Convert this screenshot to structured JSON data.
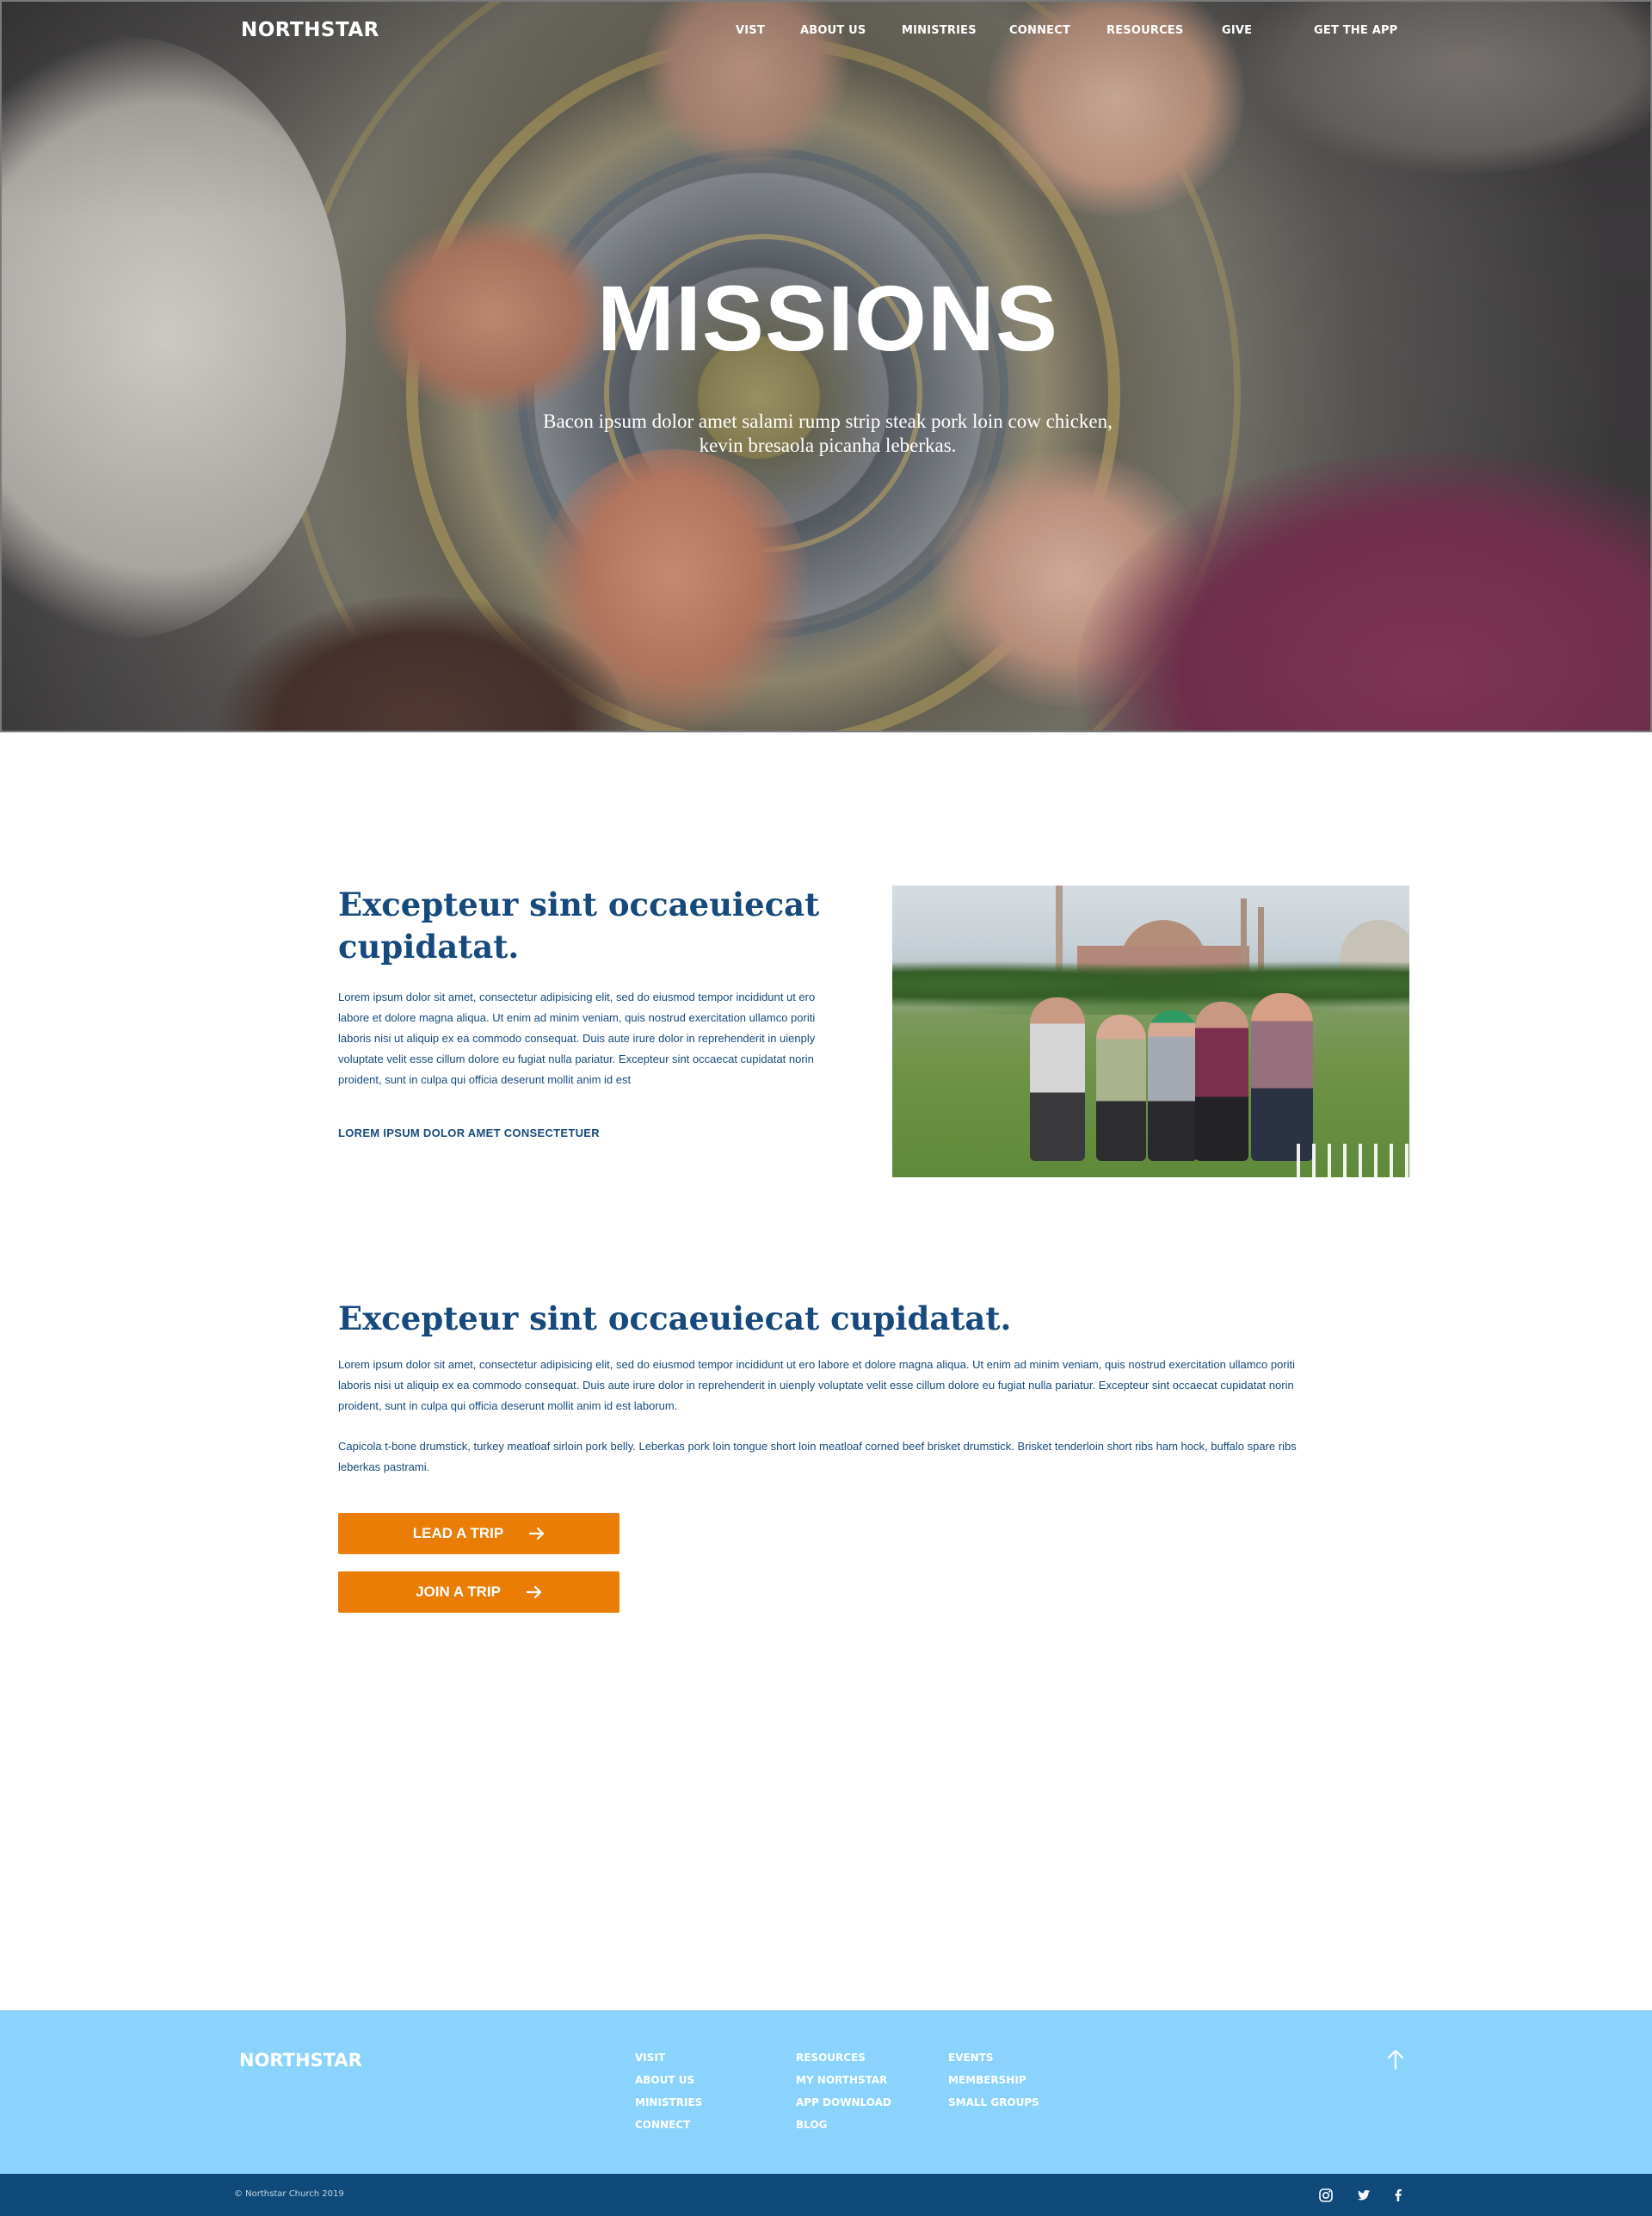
{
  "header": {
    "brand": "NORTHSTAR",
    "nav": [
      "VIST",
      "ABOUT US",
      "MINISTRIES",
      "CONNECT",
      "RESOURCES",
      "GIVE"
    ],
    "app_link": "GET THE APP"
  },
  "hero": {
    "title": "MISSIONS",
    "subtitle": "Bacon ipsum dolor amet salami rump strip steak pork loin cow chicken, kevin bresaola picanha leberkas."
  },
  "section1": {
    "heading": "Excepteur sint occaeuiecat cupidatat.",
    "body": "Lorem ipsum dolor sit amet, consectetur adipisicing elit, sed do eiusmod tempor incididunt ut ero labore et dolore magna aliqua. Ut enim ad minim veniam, quis nostrud exercitation ullamco poriti laboris nisi ut aliquip ex ea commodo consequat. Duis aute irure dolor in reprehenderit in uienply voluptate velit esse cillum dolore eu fugiat nulla pariatur. Excepteur sint occaecat cupidatat norin proident, sunt in culpa qui officia deserunt mollit anim id est",
    "link": "LOREM IPSUM DOLOR AMET CONSECTETUER"
  },
  "section2": {
    "heading": "Excepteur sint occaeuiecat cupidatat.",
    "body": "Lorem ipsum dolor sit amet, consectetur adipisicing elit, sed do eiusmod tempor incididunt ut ero labore et dolore magna aliqua. Ut enim ad minim veniam, quis nostrud exercitation ullamco poriti laboris nisi ut aliquip ex ea commodo consequat. Duis aute irure dolor in reprehenderit in uienply voluptate velit esse cillum dolore eu fugiat nulla pariatur. Excepteur sint occaecat cupidatat norin proident, sunt in culpa qui officia deserunt mollit anim id est laborum.",
    "body2": "Capicola t-bone drumstick, turkey meatloaf sirloin pork belly. Leberkas pork loin tongue short loin meatloaf corned beef brisket drumstick. Brisket tenderloin short ribs ham hock, buffalo spare ribs leberkas pastrami.",
    "buttons": [
      "LEAD A TRIP",
      "JOIN A TRIP"
    ]
  },
  "footer": {
    "brand": "NORTHSTAR",
    "columns": [
      [
        "VISIT",
        "ABOUT US",
        "MINISTRIES",
        "CONNECT"
      ],
      [
        "RESOURCES",
        "MY NORTHSTAR",
        "APP DOWNLOAD",
        "BLOG"
      ],
      [
        "EVENTS",
        "MEMBERSHIP",
        "SMALL GROUPS"
      ]
    ],
    "copyright": "© Northstar Church 2019",
    "social": [
      "instagram-icon",
      "twitter-icon",
      "facebook-icon"
    ]
  },
  "colors": {
    "accent": "#e97d06",
    "navy": "#0f4a7a",
    "heading": "#174a7c",
    "footer_bg": "#8ad3fc"
  }
}
